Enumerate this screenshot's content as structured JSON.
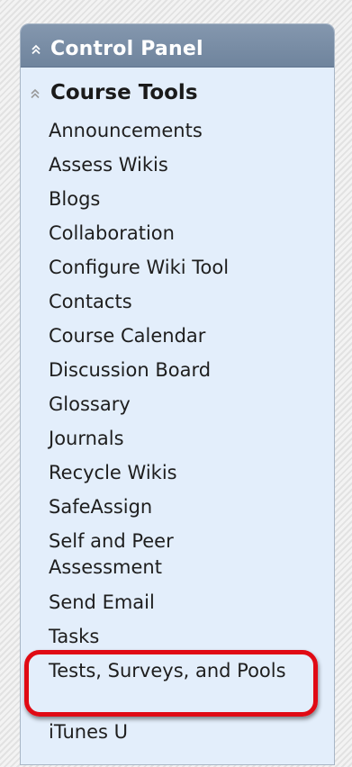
{
  "panel": {
    "title": "Control Panel",
    "collapse_icon": "double-chevron-up-icon"
  },
  "section": {
    "title": "Course Tools",
    "collapse_icon": "double-chevron-up-icon"
  },
  "items": [
    {
      "label": "Announcements"
    },
    {
      "label": "Assess Wikis"
    },
    {
      "label": "Blogs"
    },
    {
      "label": "Collaboration"
    },
    {
      "label": "Configure Wiki Tool"
    },
    {
      "label": "Contacts"
    },
    {
      "label": "Course Calendar"
    },
    {
      "label": "Discussion Board"
    },
    {
      "label": "Glossary"
    },
    {
      "label": "Journals"
    },
    {
      "label": "Recycle Wikis"
    },
    {
      "label": "SafeAssign"
    },
    {
      "label": "Self and Peer Assessment"
    },
    {
      "label": "Send Email"
    },
    {
      "label": "Tasks"
    },
    {
      "label": "Tests, Surveys, and Pools",
      "highlighted": true
    },
    {
      "label": "iTunes U"
    }
  ],
  "colors": {
    "header_bg": "#7a8da6",
    "panel_bg": "#e3eefb",
    "highlight": "#e00a14"
  }
}
